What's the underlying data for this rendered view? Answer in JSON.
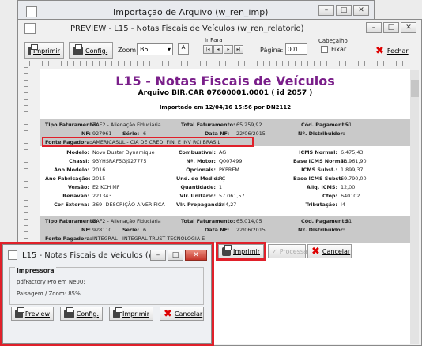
{
  "bg_window": {
    "title": "Importação de Arquivo (w_ren_imp)"
  },
  "preview": {
    "title": "PREVIEW - L15 - Notas Fiscais de Veículos (w_ren_relatorio)",
    "toolbar": {
      "imprimir": "Imprimir",
      "config": "Config.",
      "zoom_label": "Zoom:",
      "zoom_value": "B5",
      "ir_para": "Ir Para",
      "pagina_label": "Página:",
      "pagina_value": "001",
      "cabecalho": "Cabeçalho",
      "fixar": "Fixar",
      "fechar": "Fechar"
    },
    "report": {
      "title": "L15 - Notas Fiscais de Veículos",
      "file": "Arquivo BIR.CAR 07600001.0001 ( id 2057 )",
      "imported": "Importado em 12/04/16 15:56 por DN2112",
      "rec1": {
        "tipo_lbl": "Tipo Faturamento:",
        "tipo": "ZAF2 - Alienação Fiduciária",
        "total_lbl": "Total Faturamento:",
        "total": "65.259,92",
        "cod_lbl": "Cód. Pagamento:",
        "cod": "51",
        "nf_lbl": "NF:",
        "nf": "927961",
        "serie_lbl": "Série:",
        "serie": "6",
        "data_lbl": "Data NF:",
        "data": "22/06/2015",
        "dist_lbl": "Nº. Distribuidor:",
        "dist": "",
        "fonte_lbl": "Fonte Pagadora:",
        "fonte": "AMERICASUL - CIA DE CRED. FIN. E INV RCI BRASIL"
      },
      "details": [
        [
          "Modelo:",
          "Novo Duster Dynamique",
          "Combustível:",
          "AG",
          "ICMS Normal:",
          "6.475,43"
        ],
        [
          "Chassi:",
          "93YHSRAF5GJ927775",
          "Nº. Motor:",
          "Q007499",
          "Base ICMS Normal:",
          "53.961,90"
        ],
        [
          "Ano Modelo:",
          "2016",
          "Opcionais:",
          "PKPREM",
          "ICMS Subst.:",
          "1.899,37"
        ],
        [
          "Ano Fabricação:",
          "2015",
          "Und. de Medida:",
          "PÇ",
          "Base ICMS Subst:",
          "69.790,00"
        ],
        [
          "Versão:",
          "E2 KCH MF",
          "Quantidade:",
          "1",
          "Aliq. ICMS:",
          "12,00"
        ],
        [
          "Renavan:",
          "221343",
          "Vlr. Unitário:",
          "57.061,57",
          "Cfop:",
          "640102"
        ],
        [
          "Cor Externa:",
          "369 -DESCRIÇÃO A VERIFICA",
          "Vlr. Propaganda:",
          "244,27",
          "Tributação:",
          "I4"
        ]
      ],
      "rec2": {
        "tipo": "ZAF2 - Alienação Fiduciária",
        "total": "65.014,05",
        "cod": "51",
        "nf": "928110",
        "serie": "6",
        "data": "22/06/2015",
        "fonte": "INTEGRAL   - INTEGRAL-TRUST TECNOLOGIA E"
      }
    },
    "bottom": {
      "imprimir": "Imprimir",
      "processar": "Processar",
      "cancelar": "Cancelar"
    }
  },
  "dialog": {
    "title": "L15 - Notas Fiscais de Veículos (w...",
    "group": "Impressora",
    "printer": "pdfFactory Pro em Ne00:",
    "page": "Paisagem / Zoom: 85%",
    "buttons": {
      "preview": "Preview",
      "config": "Config.",
      "imprimir": "Imprimir",
      "cancelar": "Cancelar"
    }
  },
  "colors": {
    "title_purple": "#7a1f8a",
    "highlight_red": "#e0202a",
    "row_gray": "#c9c9c9"
  }
}
